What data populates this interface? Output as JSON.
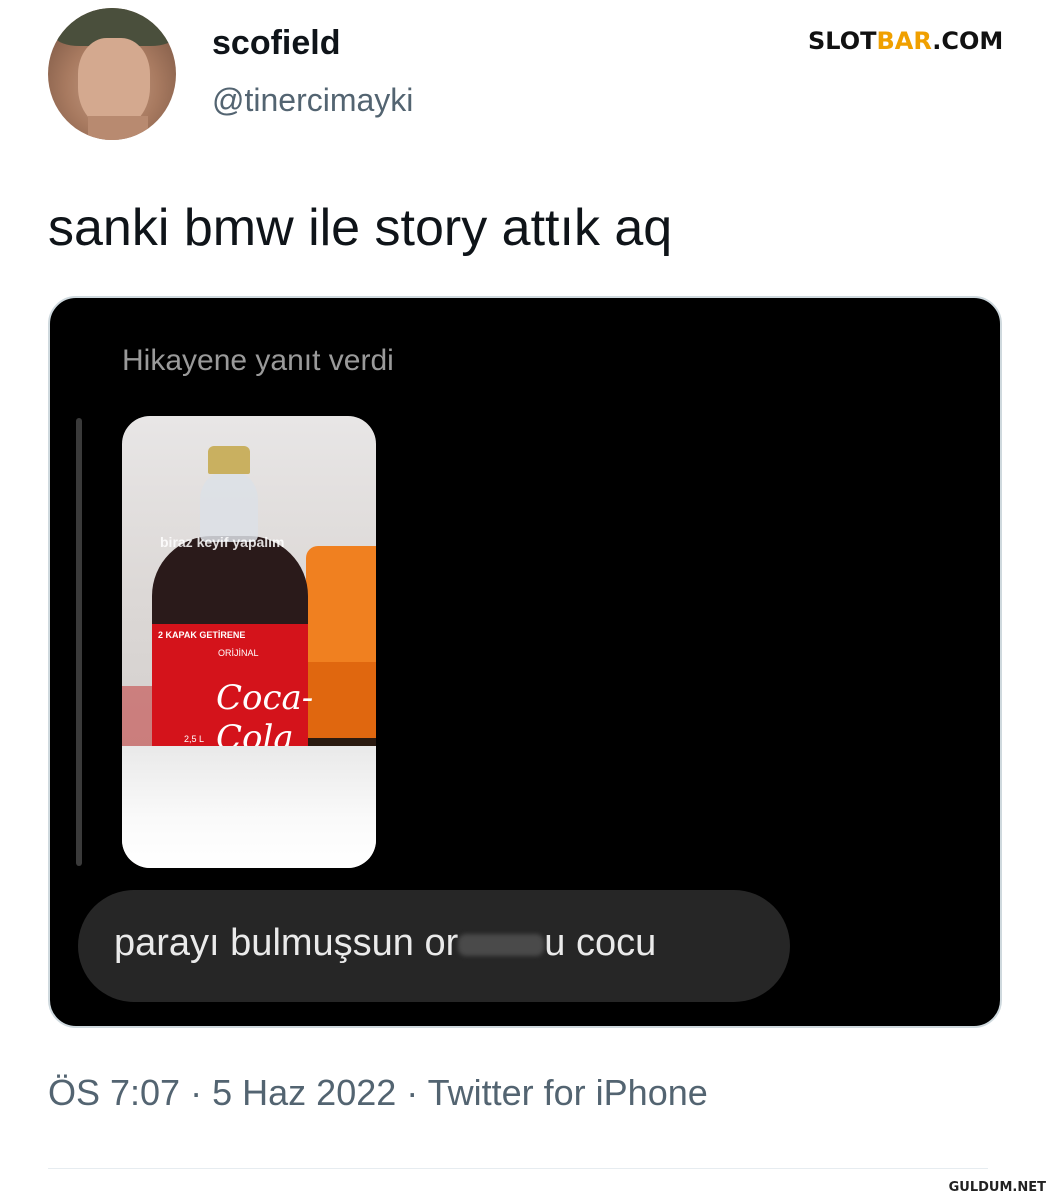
{
  "author": {
    "display_name": "scofield",
    "handle": "@tinercimayki"
  },
  "watermark_top": {
    "prefix": "SLOT",
    "accent": "BAR",
    "suffix": ".COM"
  },
  "tweet": {
    "text": "sanki bmw ile story attık aq",
    "timestamp": "ÖS 7:07",
    "date": "5 Haz 2022",
    "source": "Twitter for iPhone",
    "separator": "·"
  },
  "media": {
    "reply_label": "Hikayene yanıt verdi",
    "story": {
      "caption": "biraz keyif yapalım",
      "label_top": "2 KAPAK GETİRENE",
      "label_original": "ORİJİNAL",
      "label_brand": "Coca-Cola",
      "label_volume": "2,5 L"
    },
    "message": {
      "before": "parayı bulmuşsun or",
      "after": "u cocu"
    }
  },
  "watermark_bottom": "GULDUM.NET",
  "colors": {
    "background": "#ffffff",
    "text_primary": "#0f1419",
    "text_secondary": "#536471",
    "media_bg": "#000000",
    "bubble_bg": "#262626",
    "watermark_accent": "#f0a000"
  }
}
